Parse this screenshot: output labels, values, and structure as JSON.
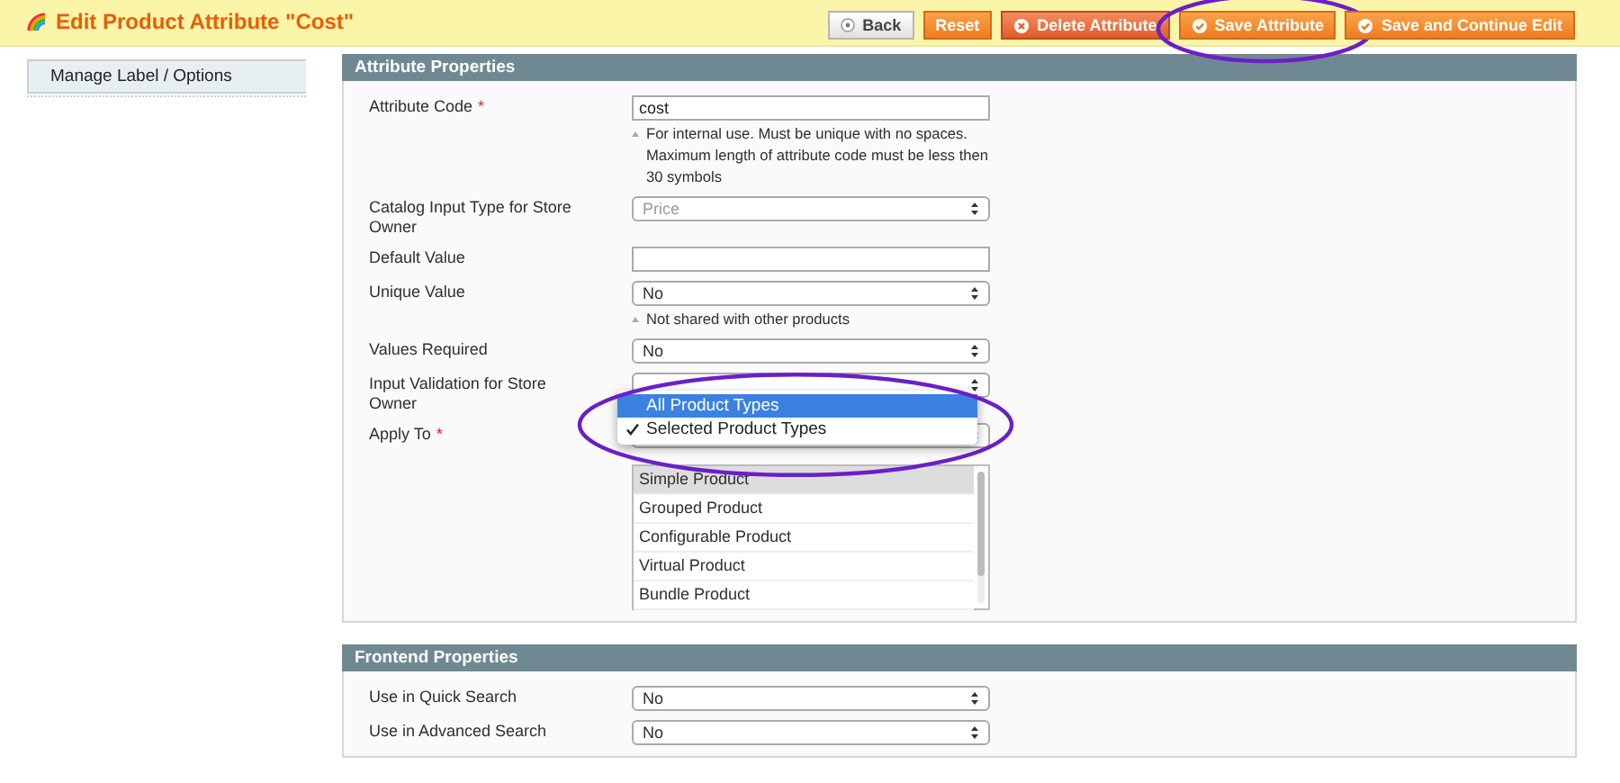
{
  "header": {
    "title": "Edit Product Attribute \"Cost\"",
    "buttons": [
      {
        "kind": "back",
        "label": "Back",
        "circled": false
      },
      {
        "kind": "plain",
        "label": "Reset",
        "circled": false
      },
      {
        "kind": "delete",
        "label": "Delete Attribute",
        "circled": false
      },
      {
        "kind": "save",
        "label": "Save Attribute",
        "circled": true
      },
      {
        "kind": "save",
        "label": "Save and Continue Edit",
        "circled": false
      }
    ]
  },
  "sidebar": {
    "tabs": [
      {
        "label": "Manage Label / Options",
        "selected": false
      }
    ]
  },
  "sections": [
    {
      "title": "Attribute Properties",
      "fields": [
        {
          "kind": "text",
          "label": "Attribute Code",
          "required_mark": "*",
          "value": "cost",
          "hint": "For internal use. Must be unique with no spaces. Maximum length of attribute code must be less then 30 symbols"
        },
        {
          "kind": "select",
          "label": "Catalog Input Type for Store Owner",
          "value": "Price",
          "disabled": true
        },
        {
          "kind": "text",
          "label": "Default Value"
        },
        {
          "kind": "select",
          "label": "Unique Value",
          "value": "No",
          "hint": "Not shared with other products"
        },
        {
          "kind": "select",
          "label": "Values Required",
          "value": "No"
        },
        {
          "kind": "select",
          "label": "Input Validation for Store Owner"
        },
        {
          "kind": "select",
          "label": "Apply To",
          "required_mark": "*",
          "popup": {
            "circled": true,
            "options": [
              {
                "label": "All Product Types",
                "highlighted": true,
                "selected": false
              },
              {
                "label": "Selected Product Types",
                "highlighted": false,
                "selected": true
              }
            ]
          }
        },
        {
          "kind": "multiselect",
          "options": [
            {
              "label": "Simple Product",
              "selected": true
            },
            {
              "label": "Grouped Product",
              "selected": false
            },
            {
              "label": "Configurable Product",
              "selected": false
            },
            {
              "label": "Virtual Product",
              "selected": false
            },
            {
              "label": "Bundle Product",
              "selected": false
            }
          ]
        }
      ]
    },
    {
      "title": "Frontend Properties",
      "fields": [
        {
          "kind": "select",
          "label": "Use in Quick Search",
          "value": "No"
        },
        {
          "kind": "select",
          "label": "Use in Advanced Search",
          "value": "No"
        }
      ]
    }
  ]
}
